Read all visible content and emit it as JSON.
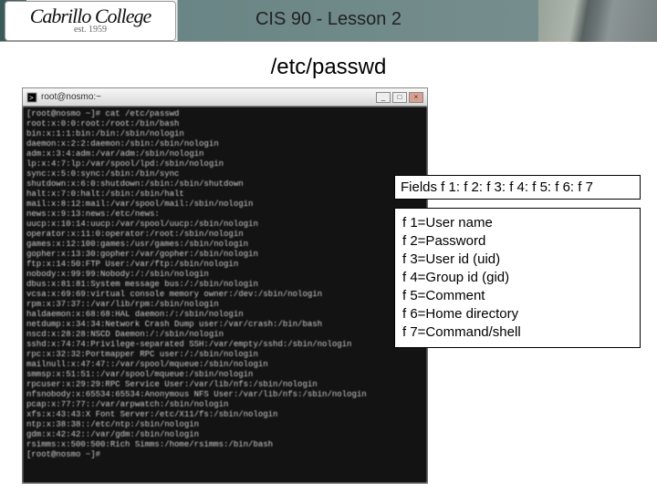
{
  "header": {
    "logo_line1": "Cabrillo College",
    "logo_line2": "est. 1959",
    "course_title": "CIS 90 - Lesson 2"
  },
  "slide": {
    "title": "/etc/passwd"
  },
  "terminal": {
    "title": "root@nosmo:~",
    "lines": [
      "[root@nosmo ~]# cat /etc/passwd",
      "root:x:0:0:root:/root:/bin/bash",
      "bin:x:1:1:bin:/bin:/sbin/nologin",
      "daemon:x:2:2:daemon:/sbin:/sbin/nologin",
      "adm:x:3:4:adm:/var/adm:/sbin/nologin",
      "lp:x:4:7:lp:/var/spool/lpd:/sbin/nologin",
      "sync:x:5:0:sync:/sbin:/bin/sync",
      "shutdown:x:6:0:shutdown:/sbin:/sbin/shutdown",
      "halt:x:7:0:halt:/sbin:/sbin/halt",
      "mail:x:8:12:mail:/var/spool/mail:/sbin/nologin",
      "news:x:9:13:news:/etc/news:",
      "uucp:x:10:14:uucp:/var/spool/uucp:/sbin/nologin",
      "operator:x:11:0:operator:/root:/sbin/nologin",
      "games:x:12:100:games:/usr/games:/sbin/nologin",
      "gopher:x:13:30:gopher:/var/gopher:/sbin/nologin",
      "ftp:x:14:50:FTP User:/var/ftp:/sbin/nologin",
      "nobody:x:99:99:Nobody:/:/sbin/nologin",
      "dbus:x:81:81:System message bus:/:/sbin/nologin",
      "vcsa:x:69:69:virtual console memory owner:/dev:/sbin/nologin",
      "rpm:x:37:37::/var/lib/rpm:/sbin/nologin",
      "haldaemon:x:68:68:HAL daemon:/:/sbin/nologin",
      "netdump:x:34:34:Network Crash Dump user:/var/crash:/bin/bash",
      "nscd:x:28:28:NSCD Daemon:/:/sbin/nologin",
      "sshd:x:74:74:Privilege-separated SSH:/var/empty/sshd:/sbin/nologin",
      "rpc:x:32:32:Portmapper RPC user:/:/sbin/nologin",
      "mailnull:x:47:47::/var/spool/mqueue:/sbin/nologin",
      "smmsp:x:51:51::/var/spool/mqueue:/sbin/nologin",
      "rpcuser:x:29:29:RPC Service User:/var/lib/nfs:/sbin/nologin",
      "nfsnobody:x:65534:65534:Anonymous NFS User:/var/lib/nfs:/sbin/nologin",
      "pcap:x:77:77::/var/arpwatch:/sbin/nologin",
      "xfs:x:43:43:X Font Server:/etc/X11/fs:/sbin/nologin",
      "ntp:x:38:38::/etc/ntp:/sbin/nologin",
      "gdm:x:42:42::/var/gdm:/sbin/nologin",
      "rsimms:x:500:500:Rich Simms:/home/rsimms:/bin/bash",
      "[root@nosmo ~]#"
    ]
  },
  "fields": {
    "header": "Fields f 1: f 2: f 3: f 4: f 5: f 6: f 7",
    "items": [
      "f 1=User name",
      "f 2=Password",
      "f 3=User id (uid)",
      "f 4=Group id (gid)",
      "f 5=Comment",
      "f 6=Home directory",
      "f 7=Command/shell"
    ]
  }
}
